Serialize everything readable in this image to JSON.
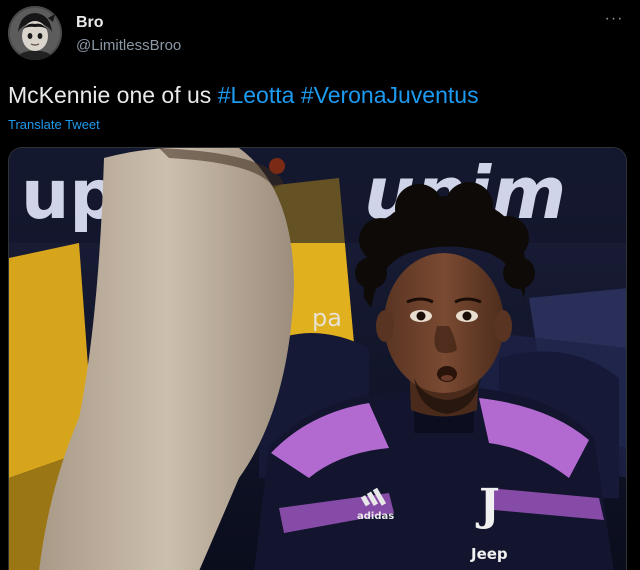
{
  "author": {
    "name": "Bro",
    "handle": "@LimitlessBroo",
    "avatar_icon": "cartoon-avatar"
  },
  "menu": {
    "more_glyph": "···",
    "more_icon": "more-horizontal-icon"
  },
  "tweet": {
    "text_prefix": "McKennie one of us",
    "hashtags": [
      "#Leotta",
      "#VeronaJuventus"
    ],
    "translate_label": "Translate Tweet"
  },
  "media": {
    "sign_left": "up",
    "sign_right": "unim",
    "board_text": "pa",
    "shirt_crest": "J",
    "shirt_sponsor": "Jeep",
    "shirt_brand": "adidas"
  },
  "colors": {
    "background": "#000000",
    "text": "#e7e9ea",
    "secondary": "#8b98a5",
    "link": "#1d9bf0"
  }
}
